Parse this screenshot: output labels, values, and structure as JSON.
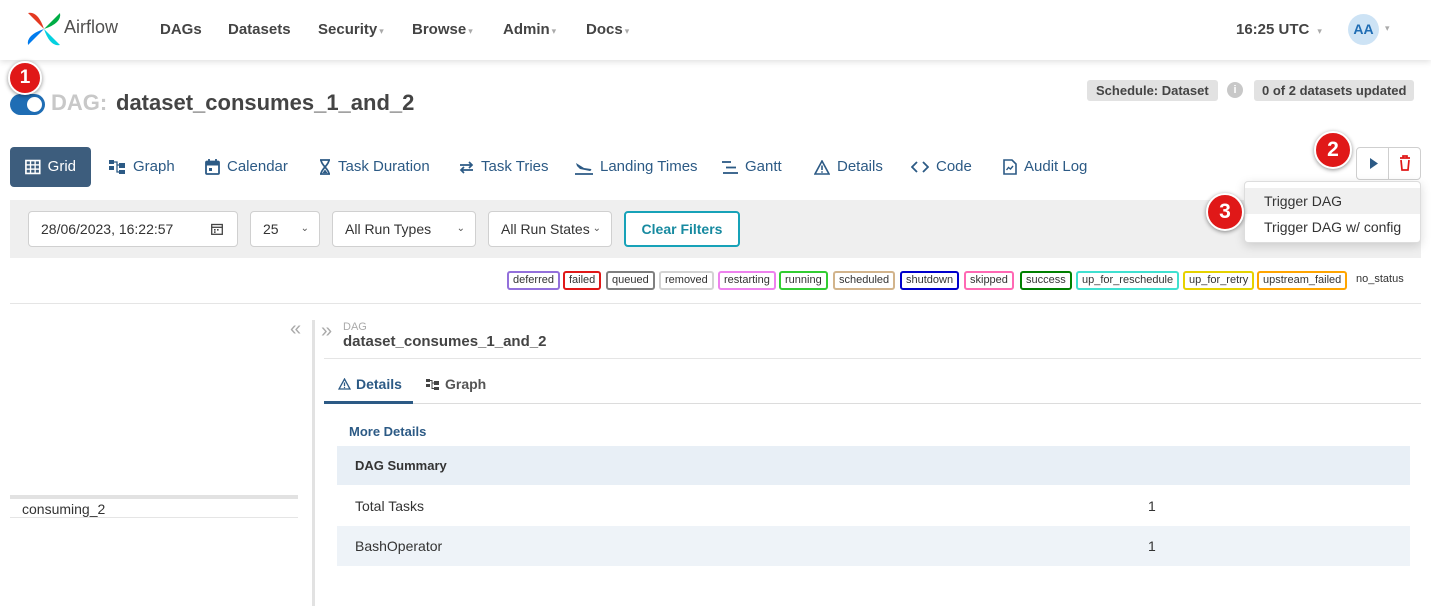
{
  "app": {
    "name": "Airflow"
  },
  "nav": {
    "items": [
      "DAGs",
      "Datasets",
      "Security",
      "Browse",
      "Admin",
      "Docs"
    ],
    "time": "16:25 UTC",
    "user_initials": "AA"
  },
  "annotations": [
    "1",
    "2",
    "3"
  ],
  "dag": {
    "prefix": "DAG:",
    "name": "dataset_consumes_1_and_2",
    "schedule": "Schedule: Dataset",
    "datasets_status": "0 of 2 datasets updated"
  },
  "tabs": [
    "Grid",
    "Graph",
    "Calendar",
    "Task Duration",
    "Task Tries",
    "Landing Times",
    "Gantt",
    "Details",
    "Code",
    "Audit Log"
  ],
  "trigger_menu": [
    "Trigger DAG",
    "Trigger DAG w/ config"
  ],
  "filters": {
    "datetime": "28/06/2023, 16:22:57",
    "num_runs": "25",
    "run_types": "All Run Types",
    "run_states": "All Run States",
    "clear_label": "Clear Filters"
  },
  "legend": [
    {
      "label": "deferred",
      "color": "#9370db"
    },
    {
      "label": "failed",
      "color": "#e01818"
    },
    {
      "label": "queued",
      "color": "#808080"
    },
    {
      "label": "removed",
      "color": "#d3d3d3"
    },
    {
      "label": "restarting",
      "color": "#ee82ee"
    },
    {
      "label": "running",
      "color": "#32cd32"
    },
    {
      "label": "scheduled",
      "color": "#d2b48c"
    },
    {
      "label": "shutdown",
      "color": "#0000cc"
    },
    {
      "label": "skipped",
      "color": "#ff69b4"
    },
    {
      "label": "success",
      "color": "#008000"
    },
    {
      "label": "up_for_reschedule",
      "color": "#40e0d0"
    },
    {
      "label": "up_for_retry",
      "color": "#e6d200"
    },
    {
      "label": "upstream_failed",
      "color": "#ffa500"
    }
  ],
  "legend_plain": "no_status",
  "grid": {
    "task": "consuming_2"
  },
  "details": {
    "label": "DAG",
    "dag_name": "dataset_consumes_1_and_2",
    "tabs": [
      "Details",
      "Graph"
    ],
    "more_details": "More Details",
    "summary_header": "DAG Summary",
    "rows": [
      {
        "key": "Total Tasks",
        "value": "1"
      },
      {
        "key": "BashOperator",
        "value": "1"
      }
    ]
  }
}
